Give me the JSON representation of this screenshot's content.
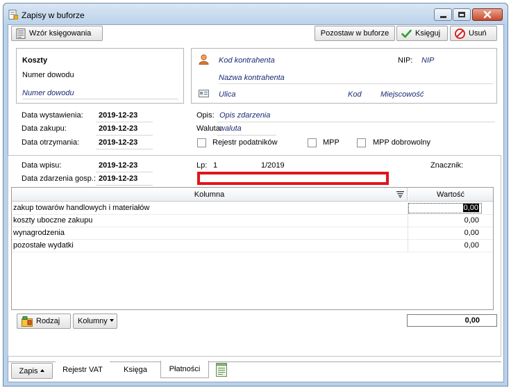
{
  "window": {
    "title": "Zapisy w buforze"
  },
  "toolbar": {
    "template_button": "Wzór księgowania",
    "leave_in_buffer_button": "Pozostaw w buforze",
    "post_button": "Księguj",
    "delete_button": "Usuń"
  },
  "costs_panel": {
    "heading": "Koszty",
    "doc_number_label": "Numer dowodu",
    "doc_number_value": "Numer dowodu"
  },
  "contractor_panel": {
    "code": "Kod kontrahenta",
    "name": "Nazwa kontrahenta",
    "street": "Ulica",
    "postal_code": "Kod",
    "city": "Miejscowość",
    "nip_label": "NIP:",
    "nip_value": "NIP"
  },
  "dates": {
    "issue_label": "Data wystawienia:",
    "issue_value": "2019-12-23",
    "purchase_label": "Data zakupu:",
    "purchase_value": "2019-12-23",
    "receipt_label": "Data otrzymania:",
    "receipt_value": "2019-12-23"
  },
  "details": {
    "description_label": "Opis:",
    "description_value": "Opis zdarzenia",
    "currency_label": "Waluta:",
    "currency_value": "waluta",
    "taxpayers_register": "Rejestr podatników",
    "mpp": "MPP",
    "mpp_voluntary": "MPP dobrowolny"
  },
  "entry": {
    "entry_date_label": "Data wpisu:",
    "entry_date_value": "2019-12-23",
    "event_date_label": "Data zdarzenia gosp.:",
    "event_date_value": "2019-12-23",
    "lp_label": "Lp:",
    "lp_value": "1",
    "number": "1/2019",
    "marker_label": "Znacznik:"
  },
  "grid": {
    "col_column": "Kolumna",
    "col_value": "Wartość",
    "rows": [
      {
        "name": "zakup towarów handlowych i materiałów",
        "value": "0,00"
      },
      {
        "name": "koszty uboczne zakupu",
        "value": "0,00"
      },
      {
        "name": "wynagrodzenia",
        "value": "0,00"
      },
      {
        "name": "pozostałe wydatki",
        "value": "0,00"
      }
    ]
  },
  "bottom": {
    "type_button": "Rodzaj",
    "columns_button": "Kolumny",
    "total": "0,00"
  },
  "tabs": {
    "entry": "Zapis",
    "vat_register": "Rejestr VAT",
    "ledger": "Księga",
    "payments": "Płatności"
  },
  "colors": {
    "highlight_box": "#e0151b",
    "post_icon": "#2ca02c",
    "delete_icon": "#d62222"
  }
}
